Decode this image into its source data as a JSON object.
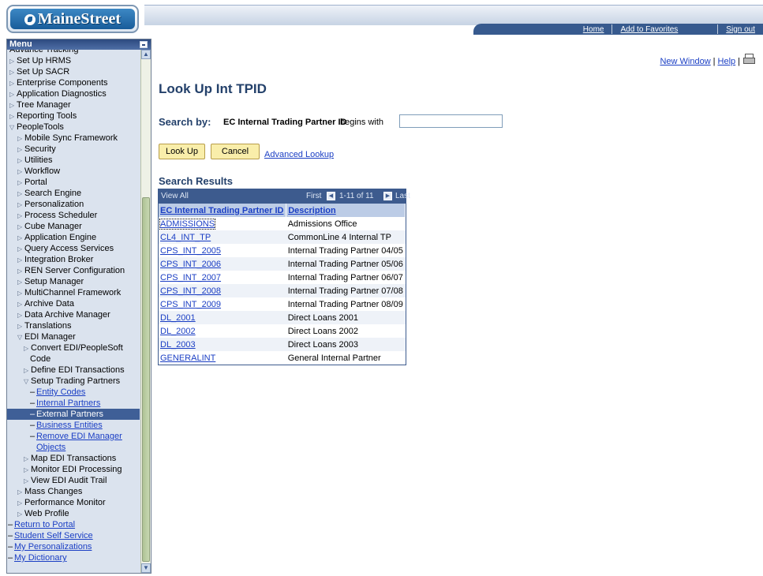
{
  "header": {
    "logo_text": "MaineStreet",
    "nav": {
      "home": "Home",
      "add_favorites": "Add to Favorites",
      "sign_out": "Sign out"
    }
  },
  "sidebar": {
    "title": "Menu",
    "clipped_item": "Advance Tracking",
    "items": [
      {
        "label": "Set Up HRMS",
        "type": "folder"
      },
      {
        "label": "Set Up SACR",
        "type": "folder"
      },
      {
        "label": "Enterprise Components",
        "type": "folder"
      },
      {
        "label": "Application Diagnostics",
        "type": "folder"
      },
      {
        "label": "Tree Manager",
        "type": "folder"
      },
      {
        "label": "Reporting Tools",
        "type": "folder"
      },
      {
        "label": "PeopleTools",
        "type": "open"
      },
      {
        "label": "Mobile Sync Framework",
        "type": "folder"
      },
      {
        "label": "Security",
        "type": "folder"
      },
      {
        "label": "Utilities",
        "type": "folder"
      },
      {
        "label": "Workflow",
        "type": "folder"
      },
      {
        "label": "Portal",
        "type": "folder"
      },
      {
        "label": "Search Engine",
        "type": "folder"
      },
      {
        "label": "Personalization",
        "type": "folder"
      },
      {
        "label": "Process Scheduler",
        "type": "folder"
      },
      {
        "label": "Cube Manager",
        "type": "folder"
      },
      {
        "label": "Application Engine",
        "type": "folder"
      },
      {
        "label": "Query Access Services",
        "type": "folder"
      },
      {
        "label": "Integration Broker",
        "type": "folder"
      },
      {
        "label": "REN Server Configuration",
        "type": "folder"
      },
      {
        "label": "Setup Manager",
        "type": "folder"
      },
      {
        "label": "MultiChannel Framework",
        "type": "folder"
      },
      {
        "label": "Archive Data",
        "type": "folder"
      },
      {
        "label": "Data Archive Manager",
        "type": "folder"
      },
      {
        "label": "Translations",
        "type": "folder"
      },
      {
        "label": "EDI Manager",
        "type": "open"
      },
      {
        "label": "Convert EDI/PeopleSoft",
        "type": "folder"
      },
      {
        "label": "Code",
        "type": "cont"
      },
      {
        "label": "Define EDI Transactions",
        "type": "folder"
      },
      {
        "label": "Setup Trading Partners",
        "type": "open"
      },
      {
        "label": "Entity Codes",
        "type": "link"
      },
      {
        "label": "Internal Partners",
        "type": "link"
      },
      {
        "label": "External Partners",
        "type": "current"
      },
      {
        "label": "Business Entities",
        "type": "link"
      },
      {
        "label": "Remove EDI Manager",
        "type": "link"
      },
      {
        "label": "Objects",
        "type": "linkcont"
      },
      {
        "label": "Map EDI Transactions",
        "type": "folder"
      },
      {
        "label": "Monitor EDI Processing",
        "type": "folder"
      },
      {
        "label": "View EDI Audit Trail",
        "type": "folder"
      },
      {
        "label": "Mass Changes",
        "type": "folder"
      },
      {
        "label": "Performance Monitor",
        "type": "folder"
      },
      {
        "label": "Web Profile",
        "type": "folder"
      },
      {
        "label": "Return to Portal",
        "type": "link"
      },
      {
        "label": "Student Self Service",
        "type": "link"
      },
      {
        "label": "My Personalizations",
        "type": "link"
      },
      {
        "label": "My Dictionary",
        "type": "link"
      }
    ]
  },
  "utility": {
    "new_window": "New Window",
    "help": "Help",
    "separator": "|"
  },
  "page": {
    "title": "Look Up Int TPID",
    "search_by_label": "Search by:",
    "search_field": "EC Internal Trading Partner ID",
    "search_operator": "begins with",
    "search_value": "",
    "lookup_button": "Look Up",
    "cancel_button": "Cancel",
    "advanced_lookup": "Advanced Lookup"
  },
  "results": {
    "title": "Search Results",
    "view_all": "View All",
    "first": "First",
    "range": "1-11 of 11",
    "last": "Last",
    "columns": [
      "EC Internal Trading Partner ID",
      "Description"
    ],
    "rows": [
      [
        "ADMISSIONS",
        "Admissions Office"
      ],
      [
        "CL4_INT_TP",
        "CommonLine 4 Internal TP"
      ],
      [
        "CPS_INT_2005",
        "Internal Trading Partner 04/05"
      ],
      [
        "CPS_INT_2006",
        "Internal Trading Partner 05/06"
      ],
      [
        "CPS_INT_2007",
        "Internal Trading Partner 06/07"
      ],
      [
        "CPS_INT_2008",
        "Internal Trading Partner 07/08"
      ],
      [
        "CPS_INT_2009",
        "Internal Trading Partner 08/09"
      ],
      [
        "DL_2001",
        "Direct Loans 2001"
      ],
      [
        "DL_2002",
        "Direct Loans 2002"
      ],
      [
        "DL_2003",
        "Direct Loans 2003"
      ],
      [
        "GENERALINT",
        "General Internal Partner"
      ]
    ]
  }
}
